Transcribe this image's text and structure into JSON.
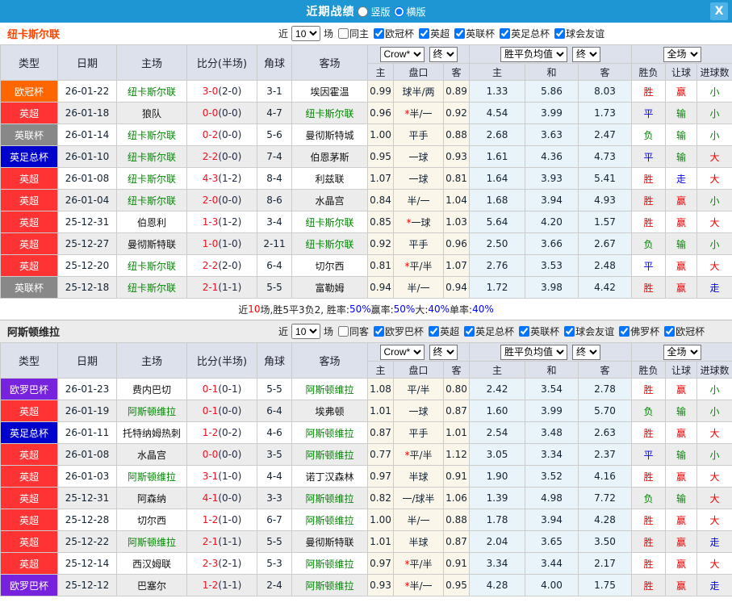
{
  "titlebar": {
    "title": "近期战绩",
    "radio_options": [
      "竖版",
      "横版"
    ],
    "selected_radio": "横版",
    "close_label": "X"
  },
  "labels": {
    "near": "近",
    "matches": "场"
  },
  "columns": {
    "left": [
      "类型",
      "日期",
      "主场",
      "比分(半场)",
      "角球",
      "客场"
    ],
    "sub": [
      "主",
      "盘口",
      "客",
      "主",
      "和",
      "客",
      "胜负",
      "让球",
      "进球数"
    ],
    "dropdown_groups": [
      [
        "Crow*",
        "终"
      ],
      [
        "胜平负均值",
        "终"
      ],
      [
        "全场"
      ]
    ]
  },
  "league_colors": {
    "欧冠杯": "#ff6600",
    "英超": "#ff3333",
    "英联杯": "#888888",
    "英足总杯": "#0000cc",
    "欧罗巴杯": "#7722dd"
  },
  "result_colors": {
    "胜": "#ee0000",
    "平": "#0000ee",
    "负": "#008800",
    "赢": "#ee0000",
    "输": "#008800",
    "走": "#0000ee",
    "大": "#ee0000",
    "小": "#008800"
  },
  "colors": {
    "self_team": "#008800",
    "opponent_team": "#111111",
    "score_ft": "#ee1122",
    "score_ht": "#222a44",
    "titlebar_bg": "#1d96d3",
    "header_bg": "#dde1ec"
  },
  "sections": [
    {
      "team": "纽卡斯尔联",
      "team_color": "#ff4400",
      "filter": {
        "count": "10",
        "same_label": "同主",
        "leagues": [
          "欧冠杯",
          "英超",
          "英联杯",
          "英足总杯",
          "球会友谊"
        ]
      },
      "rows": [
        {
          "type": "欧冠杯",
          "date": "26-01-22",
          "home": "纽卡斯尔联",
          "home_self": true,
          "ft": "3-0",
          "ht": "(2-0)",
          "corner": "3-1",
          "away": "埃因霍温",
          "away_self": false,
          "odds": [
            "0.99",
            "球半/两",
            "0.89"
          ],
          "mean": [
            "1.33",
            "5.86",
            "8.03"
          ],
          "results": [
            "胜",
            "赢",
            "小"
          ]
        },
        {
          "type": "英超",
          "date": "26-01-18",
          "home": "狼队",
          "home_self": false,
          "ft": "0-0",
          "ht": "(0-0)",
          "corner": "4-7",
          "away": "纽卡斯尔联",
          "away_self": true,
          "odds": [
            "0.96",
            "*半/一",
            "0.92"
          ],
          "mean": [
            "4.54",
            "3.99",
            "1.73"
          ],
          "results": [
            "平",
            "输",
            "小"
          ]
        },
        {
          "type": "英联杯",
          "date": "26-01-14",
          "home": "纽卡斯尔联",
          "home_self": true,
          "ft": "0-2",
          "ht": "(0-0)",
          "corner": "5-6",
          "away": "曼彻斯特城",
          "away_self": false,
          "odds": [
            "1.00",
            "平手",
            "0.88"
          ],
          "mean": [
            "2.68",
            "3.63",
            "2.47"
          ],
          "results": [
            "负",
            "输",
            "小"
          ]
        },
        {
          "type": "英足总杯",
          "date": "26-01-10",
          "home": "纽卡斯尔联",
          "home_self": true,
          "ft": "2-2",
          "ht": "(0-0)",
          "corner": "7-4",
          "away": "伯恩茅斯",
          "away_self": false,
          "odds": [
            "0.95",
            "一球",
            "0.93"
          ],
          "mean": [
            "1.61",
            "4.36",
            "4.73"
          ],
          "results": [
            "平",
            "输",
            "大"
          ]
        },
        {
          "type": "英超",
          "date": "26-01-08",
          "home": "纽卡斯尔联",
          "home_self": true,
          "ft": "4-3",
          "ht": "(1-2)",
          "corner": "8-4",
          "away": "利兹联",
          "away_self": false,
          "odds": [
            "1.07",
            "一球",
            "0.81"
          ],
          "mean": [
            "1.64",
            "3.93",
            "5.41"
          ],
          "results": [
            "胜",
            "走",
            "大"
          ]
        },
        {
          "type": "英超",
          "date": "26-01-04",
          "home": "纽卡斯尔联",
          "home_self": true,
          "ft": "2-0",
          "ht": "(0-0)",
          "corner": "8-6",
          "away": "水晶宫",
          "away_self": false,
          "odds": [
            "0.84",
            "半/一",
            "1.04"
          ],
          "mean": [
            "1.68",
            "3.94",
            "4.93"
          ],
          "results": [
            "胜",
            "赢",
            "小"
          ]
        },
        {
          "type": "英超",
          "date": "25-12-31",
          "home": "伯恩利",
          "home_self": false,
          "ft": "1-3",
          "ht": "(1-2)",
          "corner": "3-4",
          "away": "纽卡斯尔联",
          "away_self": true,
          "odds": [
            "0.85",
            "*一球",
            "1.03"
          ],
          "mean": [
            "5.64",
            "4.20",
            "1.57"
          ],
          "results": [
            "胜",
            "赢",
            "大"
          ]
        },
        {
          "type": "英超",
          "date": "25-12-27",
          "home": "曼彻斯特联",
          "home_self": false,
          "ft": "1-0",
          "ht": "(1-0)",
          "corner": "2-11",
          "away": "纽卡斯尔联",
          "away_self": true,
          "odds": [
            "0.92",
            "平手",
            "0.96"
          ],
          "mean": [
            "2.50",
            "3.66",
            "2.67"
          ],
          "results": [
            "负",
            "输",
            "小"
          ]
        },
        {
          "type": "英超",
          "date": "25-12-20",
          "home": "纽卡斯尔联",
          "home_self": true,
          "ft": "2-2",
          "ht": "(2-0)",
          "corner": "6-4",
          "away": "切尔西",
          "away_self": false,
          "odds": [
            "0.81",
            "*平/半",
            "1.07"
          ],
          "mean": [
            "2.76",
            "3.53",
            "2.48"
          ],
          "results": [
            "平",
            "赢",
            "大"
          ]
        },
        {
          "type": "英联杯",
          "date": "25-12-18",
          "home": "纽卡斯尔联",
          "home_self": true,
          "ft": "2-1",
          "ht": "(1-1)",
          "corner": "5-5",
          "away": "富勒姆",
          "away_self": false,
          "odds": [
            "0.94",
            "半/一",
            "0.94"
          ],
          "mean": [
            "1.72",
            "3.98",
            "4.42"
          ],
          "results": [
            "胜",
            "赢",
            "走"
          ]
        }
      ],
      "summary": [
        {
          "text": "近",
          "color": "#222222"
        },
        {
          "text": "10",
          "color": "#ff0000"
        },
        {
          "text": "场,胜5平3负2, 胜率:",
          "color": "#222222"
        },
        {
          "text": "50%",
          "color": "#0000ff"
        },
        {
          "text": " 赢率:",
          "color": "#222222"
        },
        {
          "text": "50%",
          "color": "#0000ff"
        },
        {
          "text": " 大:",
          "color": "#222222"
        },
        {
          "text": "40%",
          "color": "#0000ff"
        },
        {
          "text": " 单率:",
          "color": "#222222"
        },
        {
          "text": "40%",
          "color": "#0000ff"
        }
      ]
    },
    {
      "team": "阿斯顿维拉",
      "team_color": "#222222",
      "filter": {
        "count": "10",
        "same_label": "同客",
        "leagues": [
          "欧罗巴杯",
          "英超",
          "英足总杯",
          "英联杯",
          "球会友谊",
          "佛罗杯",
          "欧冠杯"
        ]
      },
      "rows": [
        {
          "type": "欧罗巴杯",
          "date": "26-01-23",
          "home": "费内巴切",
          "home_self": false,
          "ft": "0-1",
          "ht": "(0-1)",
          "corner": "5-5",
          "away": "阿斯顿维拉",
          "away_self": true,
          "odds": [
            "1.08",
            "平/半",
            "0.80"
          ],
          "mean": [
            "2.42",
            "3.54",
            "2.78"
          ],
          "results": [
            "胜",
            "赢",
            "小"
          ]
        },
        {
          "type": "英超",
          "date": "26-01-19",
          "home": "阿斯顿维拉",
          "home_self": true,
          "ft": "0-1",
          "ht": "(0-0)",
          "corner": "6-4",
          "away": "埃弗顿",
          "away_self": false,
          "odds": [
            "1.01",
            "一球",
            "0.87"
          ],
          "mean": [
            "1.60",
            "3.99",
            "5.70"
          ],
          "results": [
            "负",
            "输",
            "小"
          ]
        },
        {
          "type": "英足总杯",
          "date": "26-01-11",
          "home": "托特纳姆热刺",
          "home_self": false,
          "ft": "1-2",
          "ht": "(0-2)",
          "corner": "4-6",
          "away": "阿斯顿维拉",
          "away_self": true,
          "odds": [
            "0.87",
            "平手",
            "1.01"
          ],
          "mean": [
            "2.54",
            "3.48",
            "2.63"
          ],
          "results": [
            "胜",
            "赢",
            "大"
          ]
        },
        {
          "type": "英超",
          "date": "26-01-08",
          "home": "水晶宫",
          "home_self": false,
          "ft": "0-0",
          "ht": "(0-0)",
          "corner": "3-5",
          "away": "阿斯顿维拉",
          "away_self": true,
          "odds": [
            "0.77",
            "*平/半",
            "1.12"
          ],
          "mean": [
            "3.05",
            "3.34",
            "2.37"
          ],
          "results": [
            "平",
            "输",
            "小"
          ]
        },
        {
          "type": "英超",
          "date": "26-01-03",
          "home": "阿斯顿维拉",
          "home_self": true,
          "ft": "3-1",
          "ht": "(1-0)",
          "corner": "4-4",
          "away": "诺丁汉森林",
          "away_self": false,
          "odds": [
            "0.97",
            "半球",
            "0.91"
          ],
          "mean": [
            "1.90",
            "3.52",
            "4.16"
          ],
          "results": [
            "胜",
            "赢",
            "大"
          ]
        },
        {
          "type": "英超",
          "date": "25-12-31",
          "home": "阿森纳",
          "home_self": false,
          "ft": "4-1",
          "ht": "(0-0)",
          "corner": "3-3",
          "away": "阿斯顿维拉",
          "away_self": true,
          "odds": [
            "0.82",
            "一/球半",
            "1.06"
          ],
          "mean": [
            "1.39",
            "4.98",
            "7.72"
          ],
          "results": [
            "负",
            "输",
            "大"
          ]
        },
        {
          "type": "英超",
          "date": "25-12-28",
          "home": "切尔西",
          "home_self": false,
          "ft": "1-2",
          "ht": "(1-0)",
          "corner": "6-7",
          "away": "阿斯顿维拉",
          "away_self": true,
          "odds": [
            "1.00",
            "半/一",
            "0.88"
          ],
          "mean": [
            "1.78",
            "3.94",
            "4.28"
          ],
          "results": [
            "胜",
            "赢",
            "大"
          ]
        },
        {
          "type": "英超",
          "date": "25-12-22",
          "home": "阿斯顿维拉",
          "home_self": true,
          "ft": "2-1",
          "ht": "(1-1)",
          "corner": "5-5",
          "away": "曼彻斯特联",
          "away_self": false,
          "odds": [
            "1.01",
            "半球",
            "0.87"
          ],
          "mean": [
            "2.04",
            "3.65",
            "3.50"
          ],
          "results": [
            "胜",
            "赢",
            "走"
          ]
        },
        {
          "type": "英超",
          "date": "25-12-14",
          "home": "西汉姆联",
          "home_self": false,
          "ft": "2-3",
          "ht": "(2-1)",
          "corner": "5-3",
          "away": "阿斯顿维拉",
          "away_self": true,
          "odds": [
            "0.97",
            "*平/半",
            "0.91"
          ],
          "mean": [
            "3.34",
            "3.44",
            "2.17"
          ],
          "results": [
            "胜",
            "赢",
            "大"
          ]
        },
        {
          "type": "欧罗巴杯",
          "date": "25-12-12",
          "home": "巴塞尔",
          "home_self": false,
          "ft": "1-2",
          "ht": "(1-1)",
          "corner": "2-4",
          "away": "阿斯顿维拉",
          "away_self": true,
          "odds": [
            "0.93",
            "*半/一",
            "0.95"
          ],
          "mean": [
            "4.28",
            "4.00",
            "1.75"
          ],
          "results": [
            "胜",
            "赢",
            "走"
          ]
        }
      ],
      "summary": null
    }
  ]
}
